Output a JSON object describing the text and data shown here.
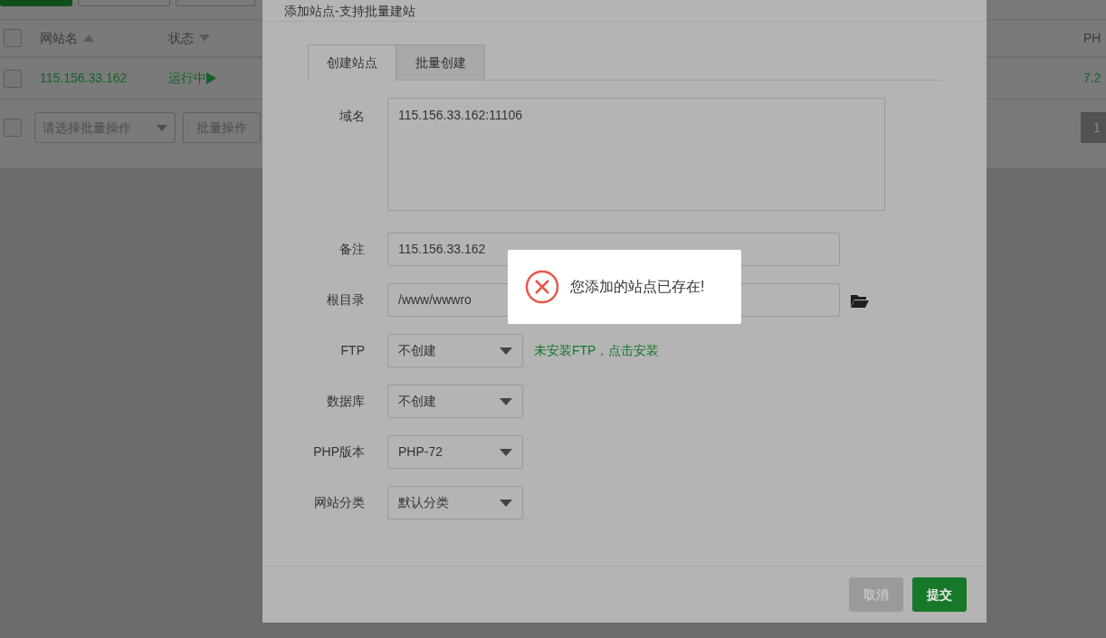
{
  "page": {
    "table": {
      "columns": [
        {
          "label": "网站名",
          "ascending": true
        },
        {
          "label": "状态",
          "ascending": false
        },
        {
          "label": "PH"
        }
      ],
      "rows": [
        {
          "name": "115.156.33.162",
          "status": "运行中",
          "php": "7.2",
          "checked": false
        }
      ],
      "header_checked": false
    },
    "footer": {
      "checked": false,
      "batch_placeholder": "请选择批量操作",
      "batch_button": "批量操作",
      "pages": [
        {
          "label": "1",
          "selected": true
        }
      ]
    }
  },
  "dialog": {
    "title": "添加站点-支持批量建站",
    "tabs": [
      {
        "label": "创建站点",
        "selected": true
      },
      {
        "label": "批量创建",
        "selected": false
      }
    ],
    "fields": [
      {
        "kind": "textarea",
        "label": "域名",
        "value": "115.156.33.162:11106"
      },
      {
        "kind": "input",
        "label": "备注",
        "value": "115.156.33.162"
      },
      {
        "kind": "folder",
        "label": "根目录",
        "value": "/www/wwwro"
      },
      {
        "kind": "select",
        "label": "FTP",
        "value": "不创建",
        "note": "未安装FTP，点击安装"
      },
      {
        "kind": "select",
        "label": "数据库",
        "value": "不创建"
      },
      {
        "kind": "select",
        "label": "PHP版本",
        "value": "PHP-72"
      },
      {
        "kind": "select",
        "label": "网站分类",
        "value": "默认分类"
      }
    ],
    "buttons": [
      {
        "label": "取消",
        "kind": "cancel"
      },
      {
        "label": "提交",
        "kind": "submit"
      }
    ]
  },
  "toast": {
    "message": "您添加的站点已存在!",
    "kind": "error"
  }
}
